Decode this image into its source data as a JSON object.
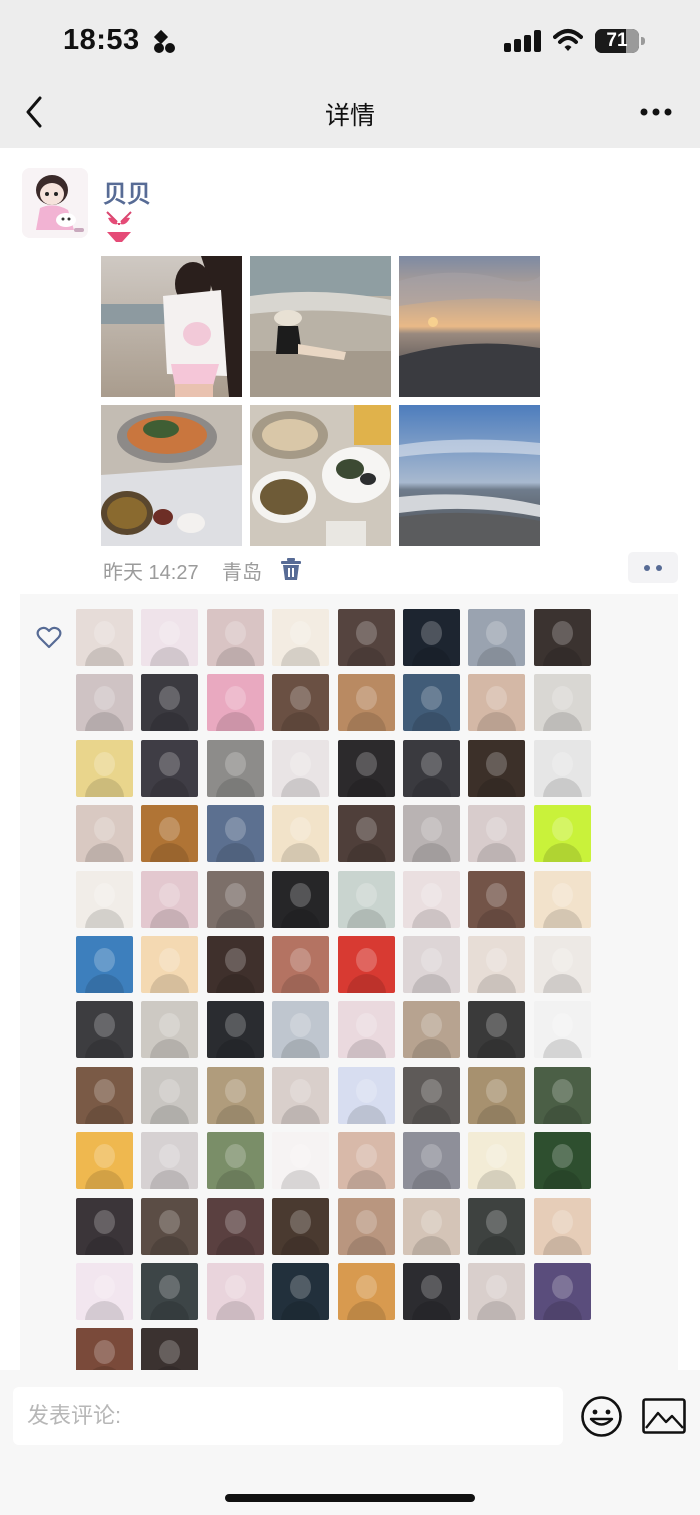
{
  "status_bar": {
    "time": "18:53",
    "battery": "71",
    "battery_level": 0.71,
    "icons": [
      "moon-icon",
      "signal-icon",
      "wifi-icon",
      "battery-icon"
    ]
  },
  "nav": {
    "title": "详情",
    "back_icon": "chevron-left-icon",
    "more_icon": "more-dots-icon"
  },
  "post": {
    "author": "贝贝",
    "content_emoji": "bikini-emoji",
    "photos": [
      "beach-selfie",
      "beach-sitting",
      "sunset-sea",
      "hotpot-dinner",
      "seafood-dinner",
      "evening-sea"
    ],
    "time": "昨天 14:27",
    "location": "青岛",
    "delete_icon": "trash-icon",
    "action_icon": "more-dots-icon"
  },
  "likes": {
    "icon": "heart-outline-icon",
    "count_shown": 90,
    "colors": [
      "#e6dcd8",
      "#efe3ea",
      "#d9c4c4",
      "#f3ece2",
      "#55443f",
      "#1d2530",
      "#9aa3b0",
      "#3b3330",
      "#cfc3c4",
      "#3b3a40",
      "#e9a9c0",
      "#6a5043",
      "#b98a62",
      "#415c78",
      "#d4b8a6",
      "#d9d7d3",
      "#e9d58c",
      "#3f3d45",
      "#8d8c8a",
      "#e9e4e5",
      "#2c2a2c",
      "#3a3a3f",
      "#3c3029",
      "#e6e6e6",
      "#d9c9c2",
      "#b07435",
      "#5c7090",
      "#f2e3c9",
      "#4f3f3a",
      "#b9b3b3",
      "#d8cccc",
      "#c9f23a",
      "#f1ede8",
      "#e3c8cf",
      "#7c6f69",
      "#262628",
      "#c9d4cf",
      "#eadfe0",
      "#735448",
      "#f2e2cb",
      "#3d7fbd",
      "#f4d9b2",
      "#3f302c",
      "#b47362",
      "#d83a32",
      "#ddd5d6",
      "#e7ddd6",
      "#ede9e5",
      "#3d3d40",
      "#cdc9c3",
      "#2a2c30",
      "#bfc6cf",
      "#ead9de",
      "#b7a390",
      "#3a3a3a",
      "#f2f2f2",
      "#7a5a46",
      "#c9c6c2",
      "#b09c7c",
      "#d9cfcb",
      "#d7ddf0",
      "#5e5a58",
      "#a7916f",
      "#4b5f46",
      "#efb84f",
      "#d6d1d2",
      "#7a8e68",
      "#f6f3f3",
      "#d8b9a9",
      "#8e8f99",
      "#f3ecd6",
      "#2e4f2f",
      "#3b3539",
      "#5b4d45",
      "#5a4040",
      "#4a3a30",
      "#b9967f",
      "#d4c4b7",
      "#3e4240",
      "#e6cdb8",
      "#f2e6ef",
      "#3d4547",
      "#e9d4dc",
      "#22303c",
      "#d89a4f",
      "#2c2c30",
      "#d9cfcc",
      "#5a4d7c",
      "#7a4a3a",
      "#3b3230"
    ]
  },
  "comment_bar": {
    "placeholder": "发表评论:",
    "emoji_icon": "smile-icon",
    "image_icon": "image-icon"
  }
}
